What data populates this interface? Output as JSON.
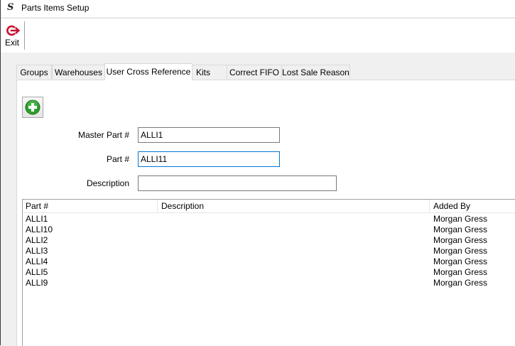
{
  "window": {
    "title": "Parts Items Setup",
    "logo_glyph": "S"
  },
  "toolbar": {
    "exit_label": "Exit",
    "exit_icon": "power-exit-icon"
  },
  "tabs": [
    {
      "label": "Groups",
      "active": false
    },
    {
      "label": "Warehouses",
      "active": false
    },
    {
      "label": "User Cross Reference",
      "active": true
    },
    {
      "label": "Kits",
      "active": false
    },
    {
      "label": "Correct FIFO",
      "active": false
    },
    {
      "label": "Lost Sale Reason",
      "active": false
    }
  ],
  "add_button": {
    "icon": "plus-circle-icon",
    "color": "#2e9e2e"
  },
  "form": {
    "master_part_label": "Master Part #",
    "master_part_value": "ALLI1",
    "part_label": "Part #",
    "part_value": "ALLI11",
    "description_label": "Description",
    "description_value": ""
  },
  "grid": {
    "headers": {
      "part": "Part #",
      "description": "Description",
      "added_by": "Added By"
    },
    "rows": [
      {
        "part": "ALLI1",
        "description": "",
        "added_by": "Morgan Gress"
      },
      {
        "part": "ALLI10",
        "description": "",
        "added_by": "Morgan Gress"
      },
      {
        "part": "ALLI2",
        "description": "",
        "added_by": "Morgan Gress"
      },
      {
        "part": "ALLI3",
        "description": "",
        "added_by": "Morgan Gress"
      },
      {
        "part": "ALLI4",
        "description": "",
        "added_by": "Morgan Gress"
      },
      {
        "part": "ALLI5",
        "description": "",
        "added_by": "Morgan Gress"
      },
      {
        "part": "ALLI9",
        "description": "",
        "added_by": "Morgan Gress"
      }
    ]
  },
  "colors": {
    "accent": "#0078d7",
    "exit_red": "#c8102e"
  }
}
